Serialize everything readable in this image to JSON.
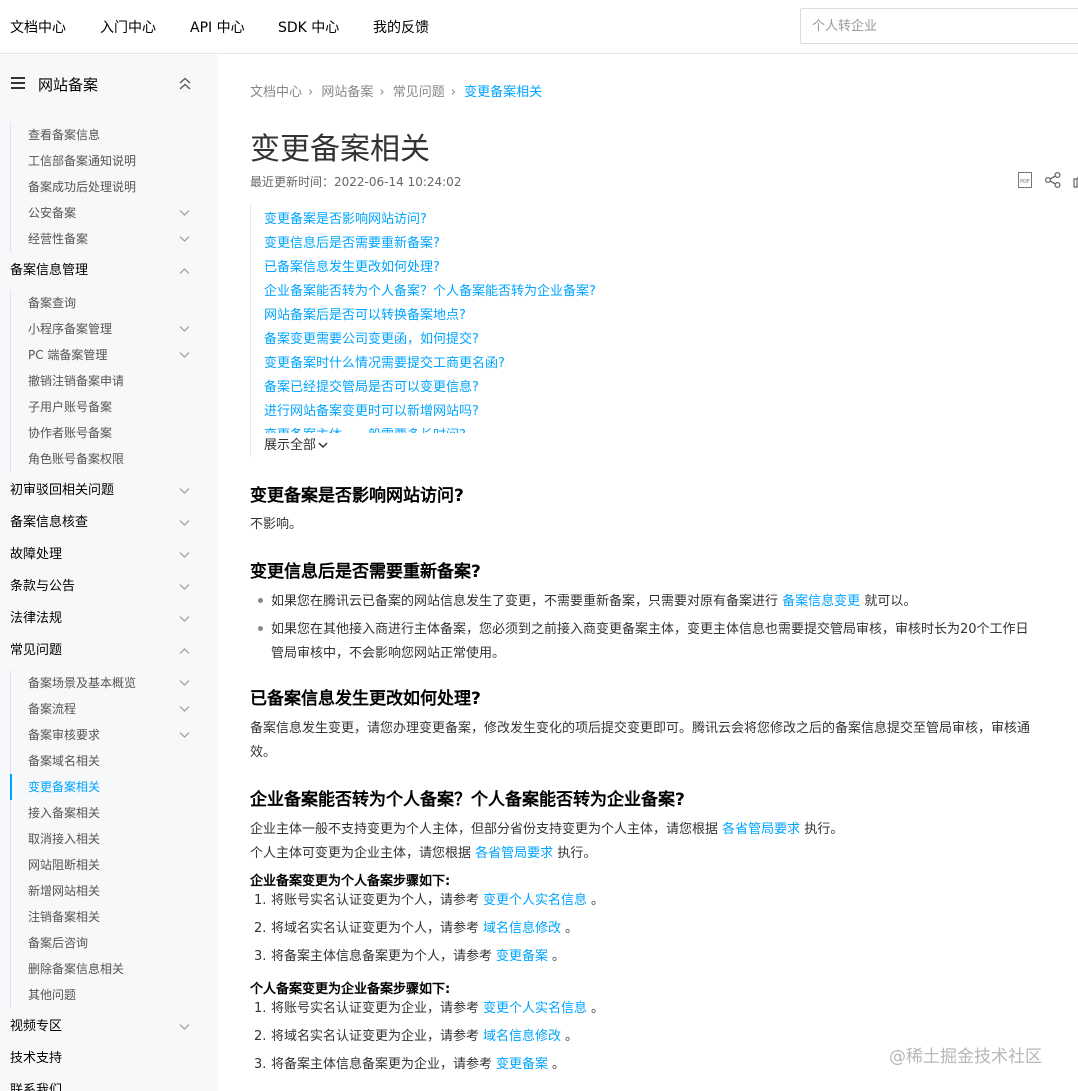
{
  "topnav": {
    "items": [
      "文档中心",
      "入门中心",
      "API 中心",
      "SDK 中心",
      "我的反馈"
    ],
    "search_placeholder": "个人转企业"
  },
  "sidebar": {
    "title": "网站备案",
    "items": [
      {
        "label": "查看备案信息",
        "level": 2
      },
      {
        "label": "工信部备案通知说明",
        "level": 2
      },
      {
        "label": "备案成功后处理说明",
        "level": 2
      },
      {
        "label": "公安备案",
        "level": 2,
        "chevron": "down"
      },
      {
        "label": "经营性备案",
        "level": 2,
        "chevron": "down"
      },
      {
        "label": "备案信息管理",
        "level": 1,
        "chevron": "up"
      },
      {
        "label": "备案查询",
        "level": 2
      },
      {
        "label": "小程序备案管理",
        "level": 2,
        "chevron": "down"
      },
      {
        "label": "PC 端备案管理",
        "level": 2,
        "chevron": "down"
      },
      {
        "label": "撤销注销备案申请",
        "level": 2
      },
      {
        "label": "子用户账号备案",
        "level": 2
      },
      {
        "label": "协作者账号备案",
        "level": 2
      },
      {
        "label": "角色账号备案权限",
        "level": 2
      },
      {
        "label": "初审驳回相关问题",
        "level": 1,
        "chevron": "down"
      },
      {
        "label": "备案信息核查",
        "level": 1,
        "chevron": "down"
      },
      {
        "label": "故障处理",
        "level": 1,
        "chevron": "down"
      },
      {
        "label": "条款与公告",
        "level": 1,
        "chevron": "down"
      },
      {
        "label": "法律法规",
        "level": 1,
        "chevron": "down"
      },
      {
        "label": "常见问题",
        "level": 1,
        "chevron": "up"
      },
      {
        "label": "备案场景及基本概览",
        "level": 2,
        "chevron": "down"
      },
      {
        "label": "备案流程",
        "level": 2,
        "chevron": "down"
      },
      {
        "label": "备案审核要求",
        "level": 2,
        "chevron": "down"
      },
      {
        "label": "备案域名相关",
        "level": 2
      },
      {
        "label": "变更备案相关",
        "level": 2,
        "active": true
      },
      {
        "label": "接入备案相关",
        "level": 2
      },
      {
        "label": "取消接入相关",
        "level": 2
      },
      {
        "label": "网站阻断相关",
        "level": 2
      },
      {
        "label": "新增网站相关",
        "level": 2
      },
      {
        "label": "注销备案相关",
        "level": 2
      },
      {
        "label": "备案后咨询",
        "level": 2
      },
      {
        "label": "删除备案信息相关",
        "level": 2
      },
      {
        "label": "其他问题",
        "level": 2
      },
      {
        "label": "视频专区",
        "level": 1,
        "chevron": "down"
      },
      {
        "label": "技术支持",
        "level": 1
      },
      {
        "label": "联系我们",
        "level": 1
      }
    ]
  },
  "breadcrumb": [
    "文档中心",
    "网站备案",
    "常见问题",
    "变更备案相关"
  ],
  "page": {
    "title": "变更备案相关",
    "updated": "最近更新时间：2022-06-14 10:24:02"
  },
  "toc": {
    "links": [
      "变更备案是否影响网站访问?",
      "变更信息后是否需要重新备案?",
      "已备案信息发生更改如何处理?",
      "企业备案能否转为个人备案？个人备案能否转为企业备案?",
      "网站备案后是否可以转换备案地点?",
      "备案变更需要公司变更函，如何提交?",
      "变更备案时什么情况需要提交工商更名函?",
      "备案已经提交管局是否可以变更信息?",
      "进行网站备案变更时可以新增网站吗?",
      "变更备案主体，一般需要多长时间?"
    ],
    "more_label": "展示全部"
  },
  "content": {
    "s1_title": "变更备案是否影响网站访问?",
    "s1_text": "不影响。",
    "s2_title": "变更信息后是否需要重新备案?",
    "s2_b1_pre": "如果您在腾讯云已备案的网站信息发生了变更，不需要重新备案，只需要对原有备案进行",
    "s2_b1_link": "备案信息变更",
    "s2_b1_post": "就可以。",
    "s2_b2_line1": "如果您在其他接入商进行主体备案，您必须到之前接入商变更备案主体，变更主体信息也需要提交管局审核，审核时长为20个工作日",
    "s2_b2_line2": "管局审核中，不会影响您网站正常使用。",
    "s3_title": "已备案信息发生更改如何处理?",
    "s3_line1": "备案信息发生变更，请您办理变更备案，修改发生变化的项后提交变更即可。腾讯云会将您修改之后的备案信息提交至管局审核，审核通",
    "s3_line2": "效。",
    "s4_title": "企业备案能否转为个人备案？个人备案能否转为企业备案?",
    "s4_p1_pre": "企业主体一般不支持变更为个人主体，但部分省份支持变更为个人主体，请您根据",
    "s4_p1_link": "各省管局要求",
    "s4_p1_post": "执行。",
    "s4_p2_pre": "个人主体可变更为企业主体，请您根据",
    "s4_p2_link": "各省管局要求",
    "s4_p2_post": "执行。",
    "s4_sub1": "企业备案变更为个人备案步骤如下:",
    "s4_list1": [
      {
        "num": "1.",
        "pre": "将账号实名认证变更为个人，请参考",
        "link": "变更个人实名信息",
        "post": "。"
      },
      {
        "num": "2.",
        "pre": "将域名实名认证变更为个人，请参考",
        "link": "域名信息修改",
        "post": "。"
      },
      {
        "num": "3.",
        "pre": "将备案主体信息备案更为个人，请参考",
        "link": "变更备案",
        "post": "。"
      }
    ],
    "s4_sub2": "个人备案变更为企业备案步骤如下:",
    "s4_list2": [
      {
        "num": "1.",
        "pre": "将账号实名认证变更为企业，请参考",
        "link": "变更个人实名信息",
        "post": "。"
      },
      {
        "num": "2.",
        "pre": "将域名实名认证变更为企业，请参考",
        "link": "域名信息修改",
        "post": "。"
      },
      {
        "num": "3.",
        "pre": "将备案主体信息备案更为企业，请参考",
        "link": "变更备案",
        "post": "。"
      }
    ]
  },
  "watermark": "@稀土掘金技术社区",
  "colors": {
    "link": "#00a4ff",
    "sidebar_bg": "#f7f8fa"
  }
}
